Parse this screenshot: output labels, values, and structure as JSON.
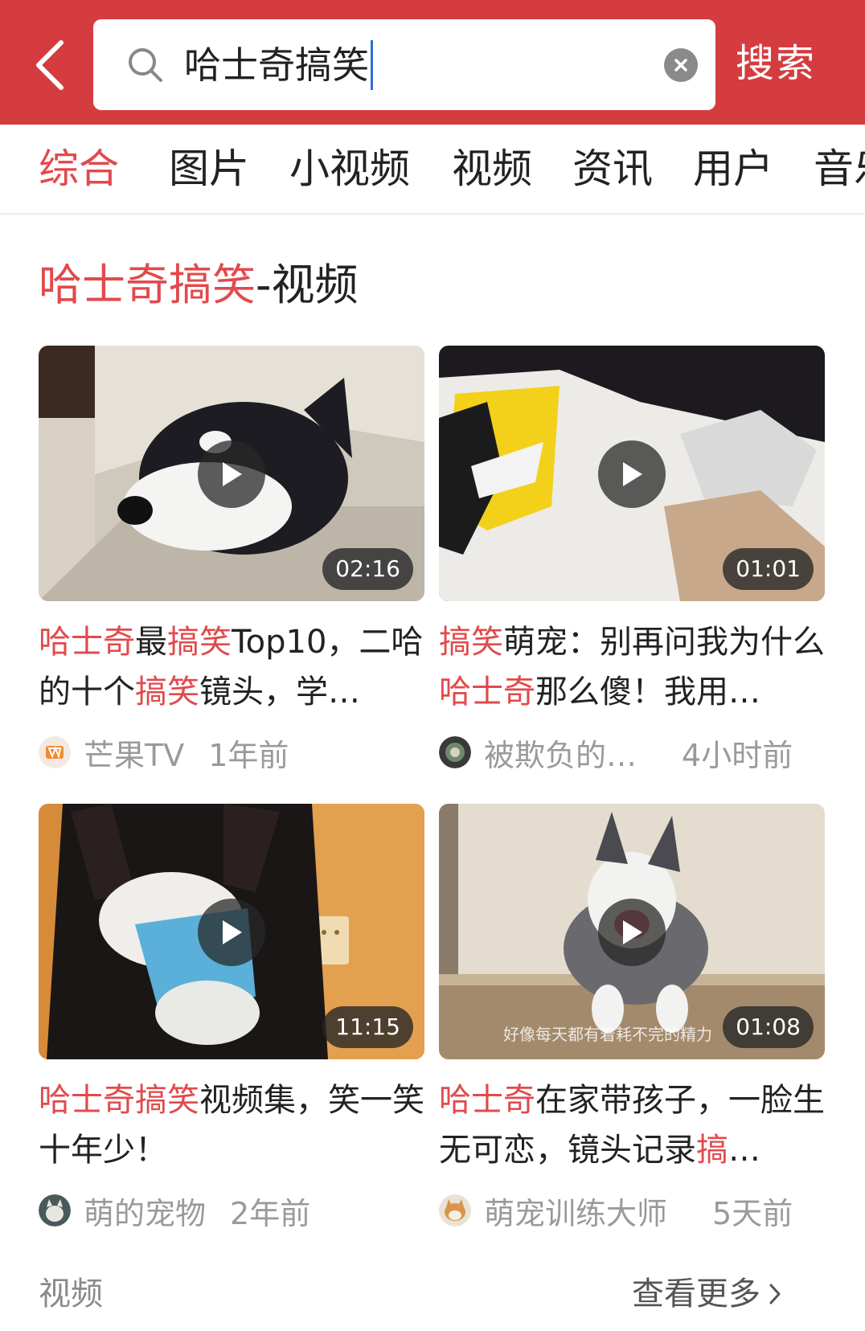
{
  "header": {
    "back_icon": "chevron-left-icon",
    "search_query": "哈士奇搞笑",
    "search_button": "搜索",
    "background_color": "#d43c3f"
  },
  "tabs": [
    {
      "label": "综合",
      "active": true
    },
    {
      "label": "图片",
      "active": false
    },
    {
      "label": "小视频",
      "active": false
    },
    {
      "label": "视频",
      "active": false
    },
    {
      "label": "资讯",
      "active": false
    },
    {
      "label": "用户",
      "active": false
    },
    {
      "label": "音乐",
      "active": false
    }
  ],
  "section": {
    "title_highlight": "哈士奇搞笑",
    "title_rest": "-视频"
  },
  "videos": [
    {
      "title_parts": [
        {
          "text": "哈士奇",
          "hl": true
        },
        {
          "text": "最",
          "hl": false
        },
        {
          "text": "搞笑",
          "hl": true
        },
        {
          "text": "Top10，二哈的十个",
          "hl": false
        },
        {
          "text": "搞笑",
          "hl": true
        },
        {
          "text": "镜头，学…",
          "hl": false
        }
      ],
      "duration": "02:16",
      "author": "芒果TV",
      "time": "1年前"
    },
    {
      "title_parts": [
        {
          "text": "搞笑",
          "hl": true
        },
        {
          "text": "萌宠：别再问我为什么",
          "hl": false
        },
        {
          "text": "哈士奇",
          "hl": true
        },
        {
          "text": "那么傻！我用…",
          "hl": false
        }
      ],
      "duration": "01:01",
      "author": "被欺负的…",
      "time": "4小时前"
    },
    {
      "title_parts": [
        {
          "text": "哈士奇搞笑",
          "hl": true
        },
        {
          "text": "视频集，笑一笑十年少！",
          "hl": false
        }
      ],
      "duration": "11:15",
      "author": "萌的宠物",
      "time": "2年前"
    },
    {
      "title_parts": [
        {
          "text": "哈士奇",
          "hl": true
        },
        {
          "text": "在家带孩子，一脸生无可恋，镜头记录",
          "hl": false
        },
        {
          "text": "搞",
          "hl": true
        },
        {
          "text": "…",
          "hl": false
        }
      ],
      "duration": "01:08",
      "author": "萌宠训练大师",
      "time": "5天前",
      "overlay_text": "好像每天都有着耗不完的精力"
    }
  ],
  "footer": {
    "left": "视频",
    "right": "查看更多"
  },
  "colors": {
    "accent": "#e14a4d",
    "text": "#222222",
    "meta": "#9a9a9a"
  }
}
